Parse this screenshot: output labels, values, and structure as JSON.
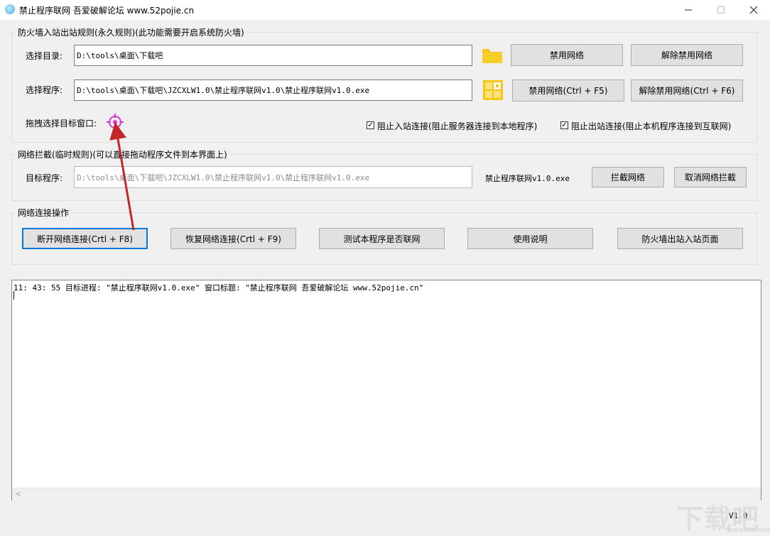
{
  "window": {
    "title": "禁止程序联网 吾爱破解论坛 www.52pojie.cn"
  },
  "firewall_group": {
    "title": "防火墙入站出站规则(永久规则)(此功能需要开启系统防火墙)",
    "dir_label": "选择目录:",
    "dir_value": "D:\\tools\\桌面\\下载吧",
    "block_network_label": "禁用网络",
    "unblock_network_label": "解除禁用网络",
    "program_label": "选择程序:",
    "program_value": "D:\\tools\\桌面\\下载吧\\JZCXLW1.0\\禁止程序联网v1.0\\禁止程序联网v1.0.exe",
    "block_network_hotkey_label": "禁用网络(Ctrl + F5)",
    "unblock_network_hotkey_label": "解除禁用网络(Ctrl + F6)",
    "drag_label": "拖拽选择目标窗口:",
    "inbound_label": "阻止入站连接(阻止服务器连接到本地程序)",
    "inbound_checked": true,
    "outbound_label": "阻止出站连接(阻止本机程序连接到互联网)",
    "outbound_checked": true
  },
  "intercept_group": {
    "title": "网络拦截(临时规则)(可以直接拖动程序文件到本界面上)",
    "target_label": "目标程序:",
    "target_value": "D:\\tools\\桌面\\下载吧\\JZCXLW1.0\\禁止程序联网v1.0\\禁止程序联网v1.0.exe",
    "target_name": "禁止程序联网v1.0.exe",
    "intercept_label": "拦截网络",
    "cancel_intercept_label": "取消网络拦截"
  },
  "network_ops_group": {
    "title": "网络连接操作",
    "disconnect_label": "断开网络连接(Crtl + F8)",
    "restore_label": "恢复网络连接(Crtl + F9)",
    "test_label": "测试本程序是否联网",
    "manual_label": "使用说明",
    "firewall_page_label": "防火墙出站入站页面"
  },
  "log": {
    "line1": "11: 43: 55 目标进程: \"禁止程序联网v1.0.exe\" 窗口标题: \"禁止程序联网 吾爱破解论坛 www.52pojie.cn\""
  },
  "version": "V1.0",
  "watermark": {
    "text": "下载吧",
    "sub": "www.xiazaiba.com"
  },
  "colors": {
    "folder_icon": "#f5c518",
    "crosshair_icon": "#d63bd6",
    "arrow": "#c0282b"
  }
}
